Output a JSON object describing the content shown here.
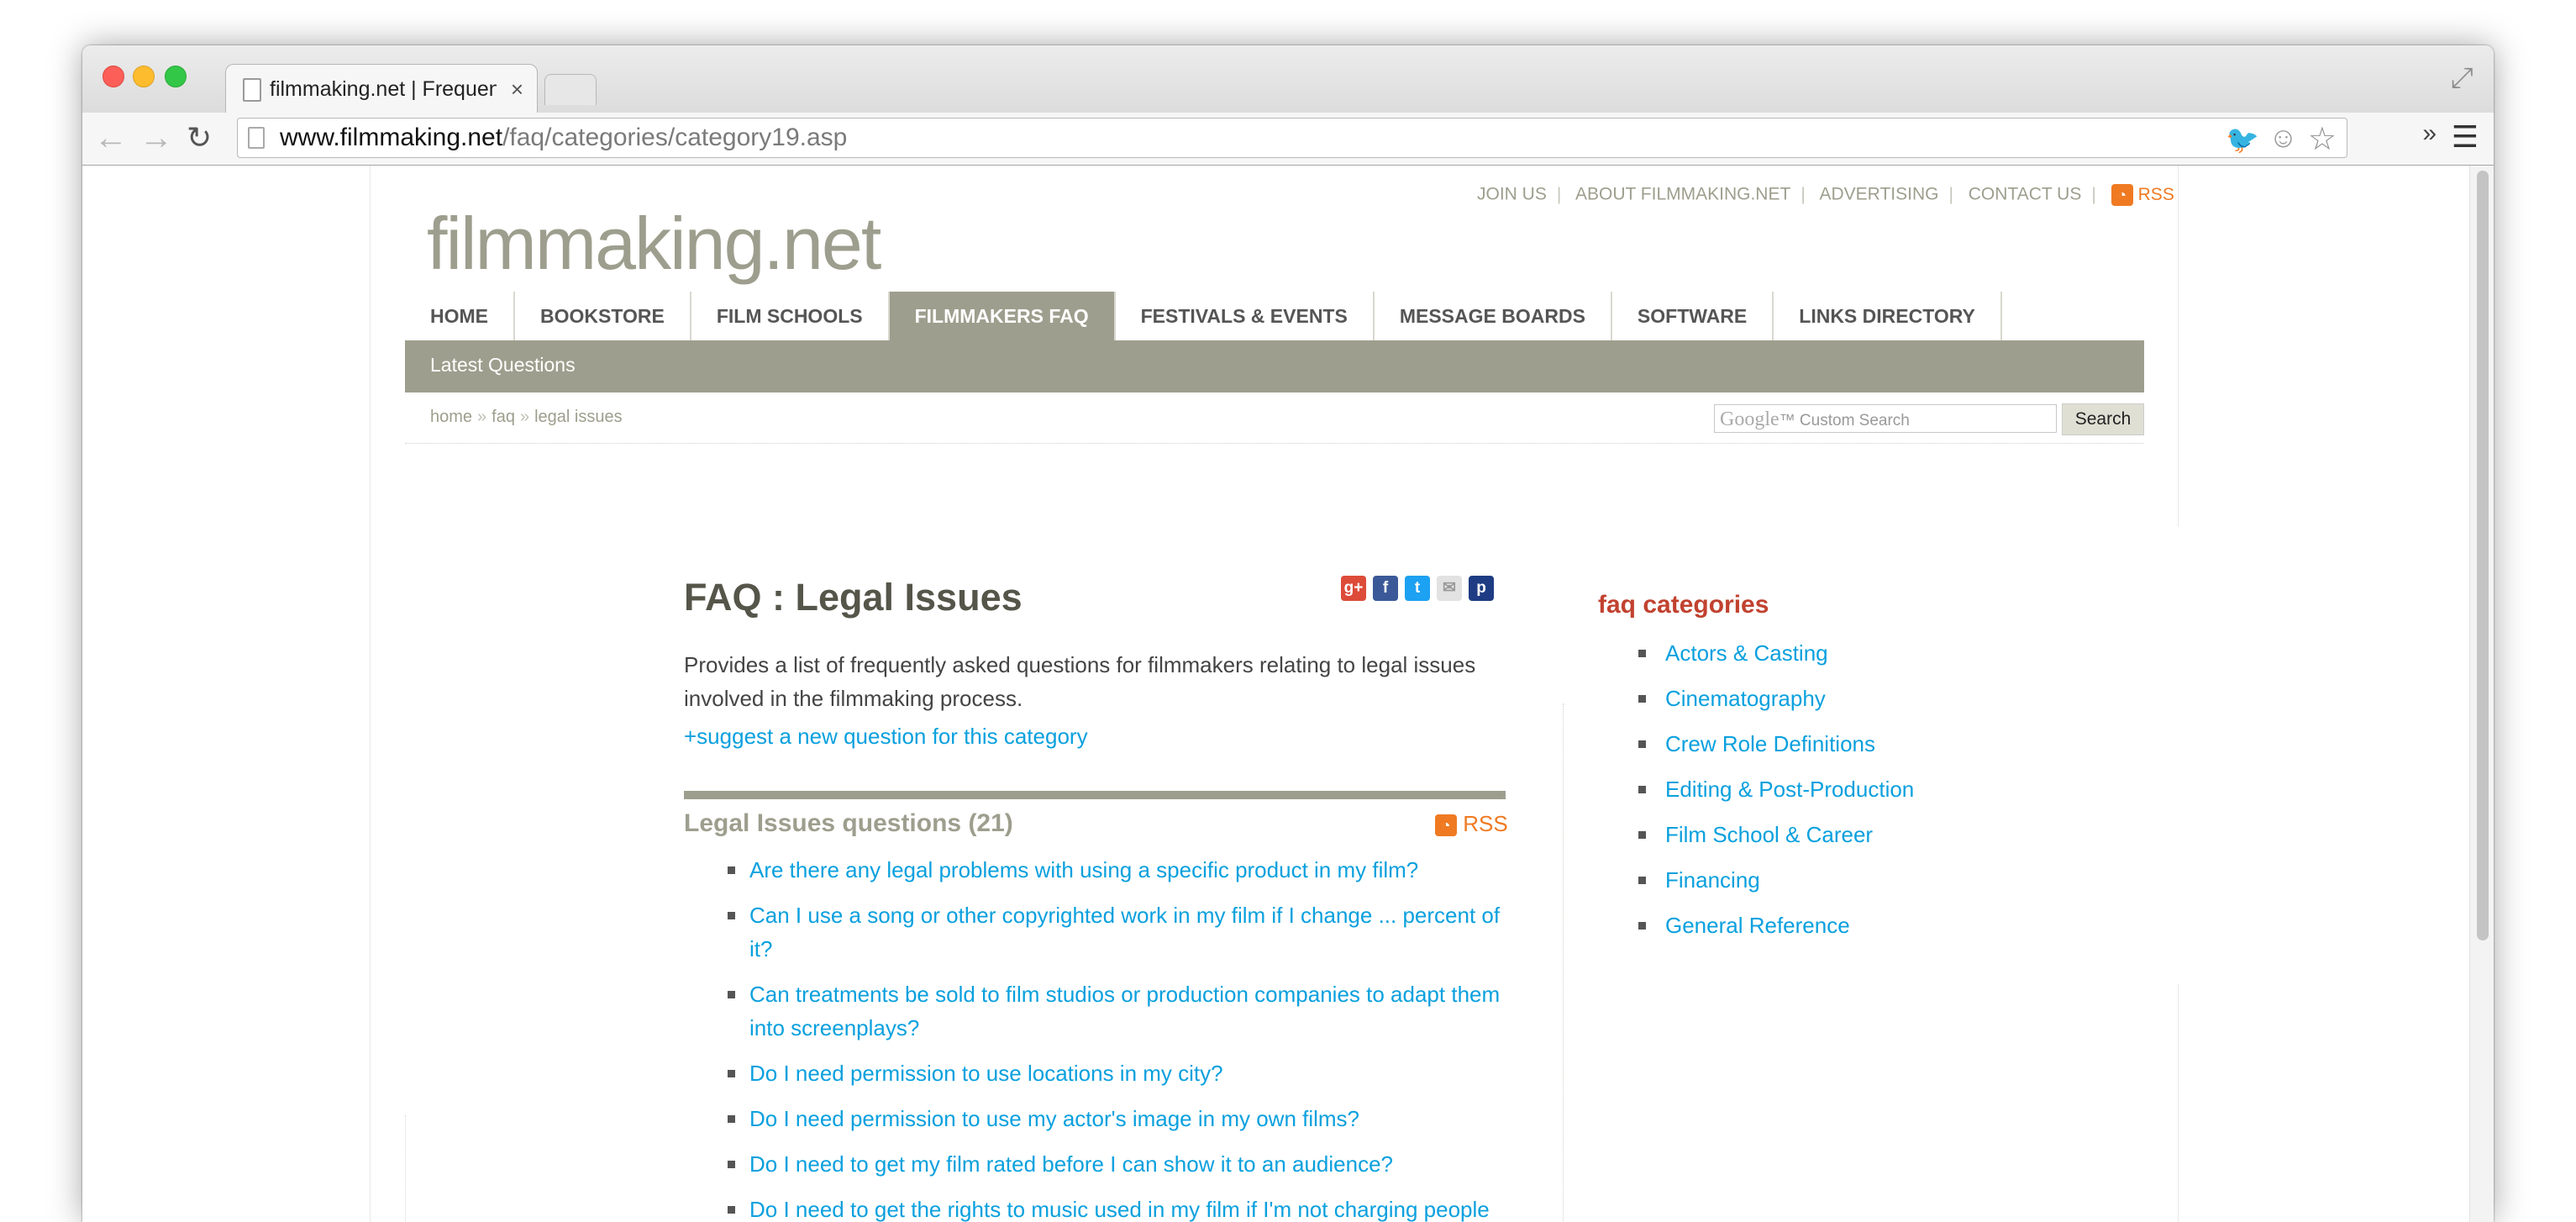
{
  "browser": {
    "tab_title": "filmmaking.net | Frequently Asked Questions",
    "tab_close": "×",
    "url_host": "www.filmmaking.net",
    "url_path": "/faq/categories/category19.asp",
    "icons": [
      "back-arrow-icon",
      "forward-arrow-icon",
      "reload-icon",
      "page-icon",
      "twitter-icon",
      "reddit-icon",
      "star-icon",
      "chevrons-icon",
      "menu-icon",
      "fullscreen-icon"
    ]
  },
  "site": {
    "logo": "filmmaking.net",
    "top_links": [
      "JOIN US",
      "ABOUT FILMMAKING.NET",
      "ADVERTISING",
      "CONTACT US"
    ],
    "top_rss": "RSS",
    "nav": [
      "HOME",
      "BOOKSTORE",
      "FILM SCHOOLS",
      "FILMMAKERS FAQ",
      "FESTIVALS & EVENTS",
      "MESSAGE BOARDS",
      "SOFTWARE",
      "LINKS DIRECTORY"
    ],
    "nav_active": "FILMMAKERS FAQ",
    "subnav": "Latest Questions",
    "breadcrumb": [
      "home",
      "faq",
      "legal issues"
    ],
    "breadcrumb_sep": "»",
    "search": {
      "placeholder_brand": "Google",
      "placeholder_text": "™ Custom Search",
      "button": "Search"
    }
  },
  "main": {
    "title": "FAQ : Legal Issues",
    "intro": "Provides a list of frequently asked questions for filmmakers relating to legal issues involved in the filmmaking process.",
    "suggest_link": "+suggest a new question for this category",
    "questions_heading": "Legal Issues questions (21)",
    "questions_rss": "RSS",
    "questions": [
      "Are there any legal problems with using a specific product in my film?",
      "Can I use a song or other copyrighted work in my film if I change ... percent of it?",
      "Can treatments be sold to film studios or production companies to adapt them into screenplays?",
      "Do I need permission to use locations in my city?",
      "Do I need permission to use my actor's image in my own films?",
      "Do I need to get my film rated before I can show it to an audience?",
      "Do I need to get the rights to music used in my film if I'm not charging people to view it?"
    ]
  },
  "sidebar": {
    "heading": "faq categories",
    "categories": [
      "Actors & Casting",
      "Cinematography",
      "Crew Role Definitions",
      "Editing & Post-Production",
      "Film School & Career",
      "Financing",
      "General Reference"
    ]
  },
  "share_icons": [
    "google-plus-icon",
    "facebook-icon",
    "twitter-icon",
    "email-icon",
    "pinterest-icon"
  ],
  "colors": {
    "accent_olive": "#9e9e8e",
    "link_blue": "#0aa0de",
    "heading_red": "#c1422f",
    "rss_orange": "#ef7a22"
  }
}
